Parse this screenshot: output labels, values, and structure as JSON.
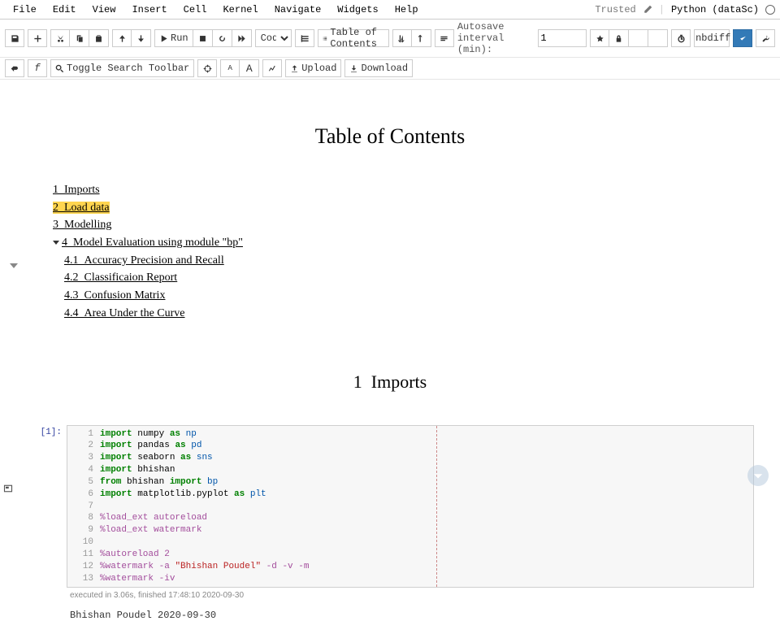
{
  "menubar": {
    "items": [
      "File",
      "Edit",
      "View",
      "Insert",
      "Cell",
      "Kernel",
      "Navigate",
      "Widgets",
      "Help"
    ],
    "trusted": "Trusted",
    "kernel": "Python (dataSc)"
  },
  "toolbar": {
    "run": "Run",
    "toc": "Table of Contents",
    "upload": "Upload",
    "download": "Download",
    "celltype": "Code",
    "nbdiff": "nbdiff",
    "autosave_label": "Autosave interval (min):",
    "autosave_value": "1",
    "toggle_search": "Toggle Search Toolbar"
  },
  "toc": {
    "title": "Table of Contents",
    "items": [
      {
        "n": "1",
        "label": "Imports"
      },
      {
        "n": "2",
        "label": "Load data",
        "highlight": true
      },
      {
        "n": "3",
        "label": "Modelling"
      },
      {
        "n": "4",
        "label": "Model Evaluation using module \"bp\"",
        "children": [
          {
            "n": "4.1",
            "label": "Accuracy Precision and Recall"
          },
          {
            "n": "4.2",
            "label": "Classificaion Report"
          },
          {
            "n": "4.3",
            "label": "Confusion Matrix"
          },
          {
            "n": "4.4",
            "label": "Area Under the Curve"
          }
        ]
      }
    ]
  },
  "section1": {
    "num": "1",
    "label": "Imports"
  },
  "cell1": {
    "prompt": "[1]:",
    "lines": [
      [
        {
          "t": "import ",
          "c": "kw"
        },
        {
          "t": "numpy ",
          "c": "nm"
        },
        {
          "t": "as ",
          "c": "as"
        },
        {
          "t": "np",
          "c": "alias"
        }
      ],
      [
        {
          "t": "import ",
          "c": "kw"
        },
        {
          "t": "pandas ",
          "c": "nm"
        },
        {
          "t": "as ",
          "c": "as"
        },
        {
          "t": "pd",
          "c": "alias"
        }
      ],
      [
        {
          "t": "import ",
          "c": "kw"
        },
        {
          "t": "seaborn ",
          "c": "nm"
        },
        {
          "t": "as ",
          "c": "as"
        },
        {
          "t": "sns",
          "c": "alias"
        }
      ],
      [
        {
          "t": "import ",
          "c": "kw"
        },
        {
          "t": "bhishan",
          "c": "nm"
        }
      ],
      [
        {
          "t": "from ",
          "c": "kw"
        },
        {
          "t": "bhishan ",
          "c": "nm"
        },
        {
          "t": "import ",
          "c": "kw"
        },
        {
          "t": "bp",
          "c": "alias"
        }
      ],
      [
        {
          "t": "import ",
          "c": "kw"
        },
        {
          "t": "matplotlib",
          "c": "nm"
        },
        {
          "t": ".pyplot ",
          "c": "nm"
        },
        {
          "t": "as ",
          "c": "as"
        },
        {
          "t": "plt",
          "c": "alias"
        }
      ],
      [],
      [
        {
          "t": "%load_ext ",
          "c": "magic"
        },
        {
          "t": "autoreload",
          "c": "magic"
        }
      ],
      [
        {
          "t": "%load_ext ",
          "c": "magic"
        },
        {
          "t": "watermark",
          "c": "magic"
        }
      ],
      [],
      [
        {
          "t": "%autoreload ",
          "c": "magic"
        },
        {
          "t": "2",
          "c": "magic"
        }
      ],
      [
        {
          "t": "%watermark ",
          "c": "magic"
        },
        {
          "t": "-a ",
          "c": "op"
        },
        {
          "t": "\"Bhishan Poudel\" ",
          "c": "str"
        },
        {
          "t": "-d -v -m",
          "c": "op"
        }
      ],
      [
        {
          "t": "%watermark ",
          "c": "magic"
        },
        {
          "t": "-iv",
          "c": "op"
        }
      ]
    ],
    "exec": "executed in 3.06s, finished 17:48:10 2020-09-30",
    "author": "Bhishan Poudel 2020-09-30"
  }
}
